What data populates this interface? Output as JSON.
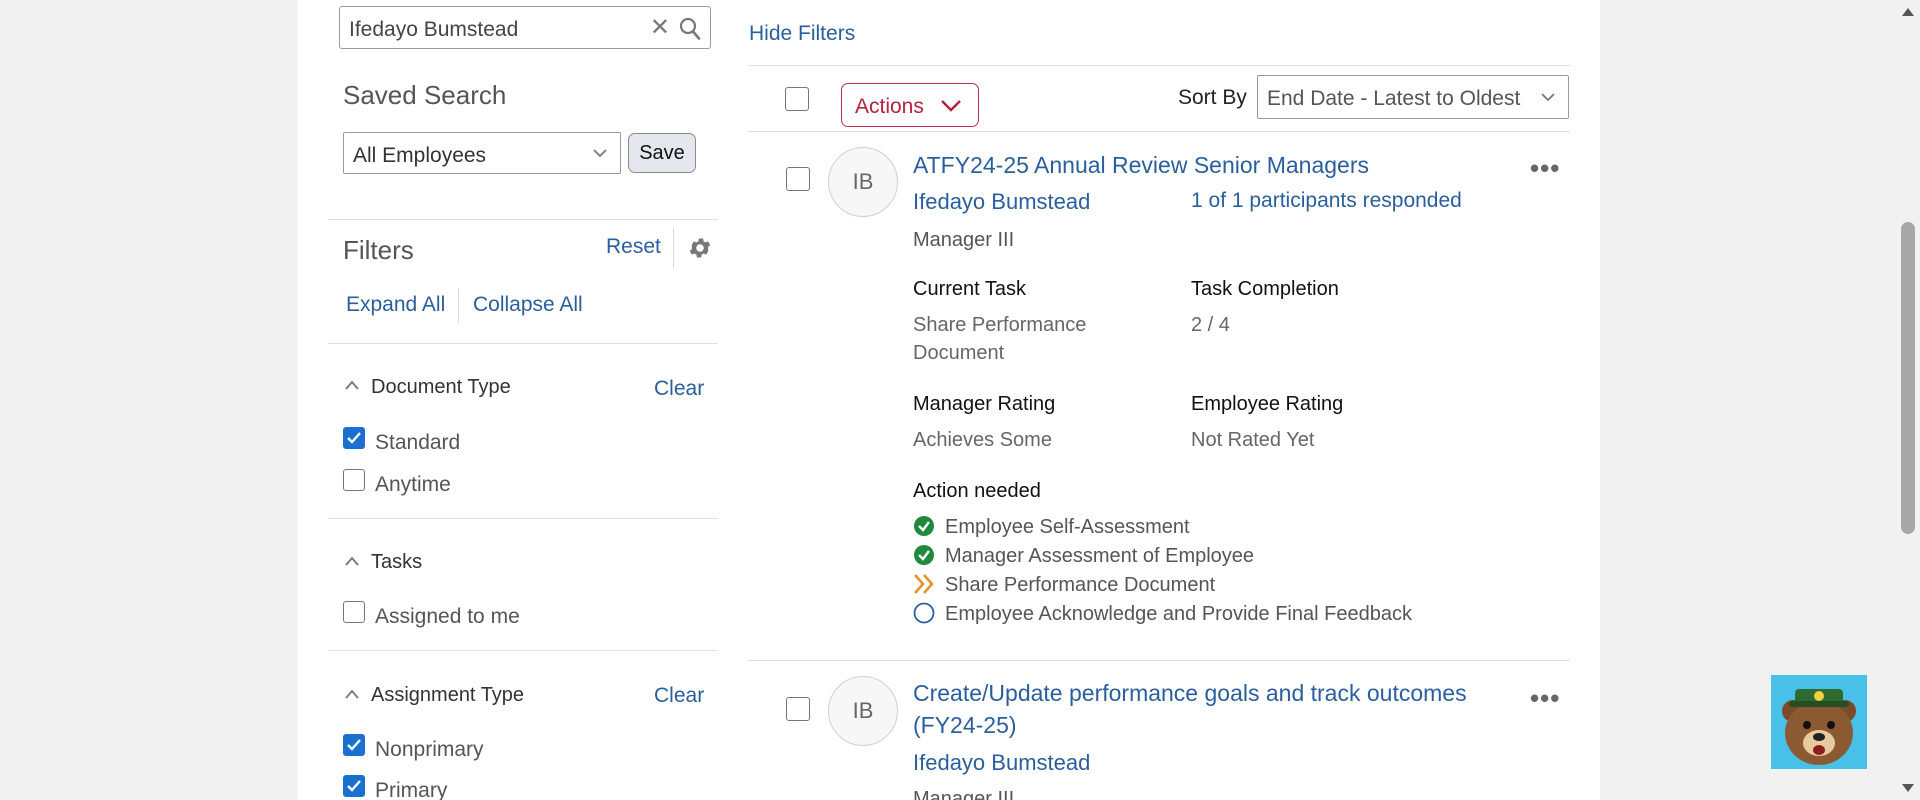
{
  "search": {
    "value": "Ifedayo Bumstead"
  },
  "toolbar": {
    "hide_filters": "Hide Filters"
  },
  "saved_search": {
    "title": "Saved Search",
    "selected": "All Employees",
    "save_label": "Save"
  },
  "filters": {
    "title": "Filters",
    "reset": "Reset",
    "expand_all": "Expand All",
    "collapse_all": "Collapse All",
    "sections": [
      {
        "title": "Document Type",
        "clear": "Clear",
        "options": [
          {
            "label": "Standard",
            "checked": true
          },
          {
            "label": "Anytime",
            "checked": false
          }
        ]
      },
      {
        "title": "Tasks",
        "options": [
          {
            "label": "Assigned to me",
            "checked": false
          }
        ]
      },
      {
        "title": "Assignment Type",
        "clear": "Clear",
        "options": [
          {
            "label": "Nonprimary",
            "checked": true
          },
          {
            "label": "Primary",
            "checked": true
          }
        ]
      }
    ]
  },
  "list_header": {
    "actions": "Actions",
    "sort_by_label": "Sort By",
    "sort_selected": "End Date - Latest to Oldest"
  },
  "cards": [
    {
      "initials": "IB",
      "title": "ATFY24-25 Annual Review Senior Managers",
      "name": "Ifedayo Bumstead",
      "responded": "1 of 1 participants responded",
      "job": "Manager III",
      "current_task_label": "Current Task",
      "current_task": "Share Performance Document",
      "task_completion_label": "Task Completion",
      "task_completion": "2 / 4",
      "manager_rating_label": "Manager Rating",
      "manager_rating": "Achieves Some",
      "employee_rating_label": "Employee Rating",
      "employee_rating": "Not Rated Yet",
      "action_needed_label": "Action needed",
      "steps": [
        {
          "label": "Employee Self-Assessment",
          "status": "complete"
        },
        {
          "label": "Manager Assessment of Employee",
          "status": "complete"
        },
        {
          "label": "Share Performance Document",
          "status": "current"
        },
        {
          "label": "Employee Acknowledge and Provide Final Feedback",
          "status": "pending"
        }
      ]
    },
    {
      "initials": "IB",
      "title": "Create/Update performance goals and track outcomes (FY24-25)",
      "name": "Ifedayo Bumstead",
      "job": "Manager III"
    }
  ],
  "colors": {
    "link": "#2a5f9e",
    "accent_red": "#b5223d",
    "check_blue": "#1a6fcf",
    "complete_green": "#1e8a3a",
    "current_orange": "#e0962a"
  }
}
